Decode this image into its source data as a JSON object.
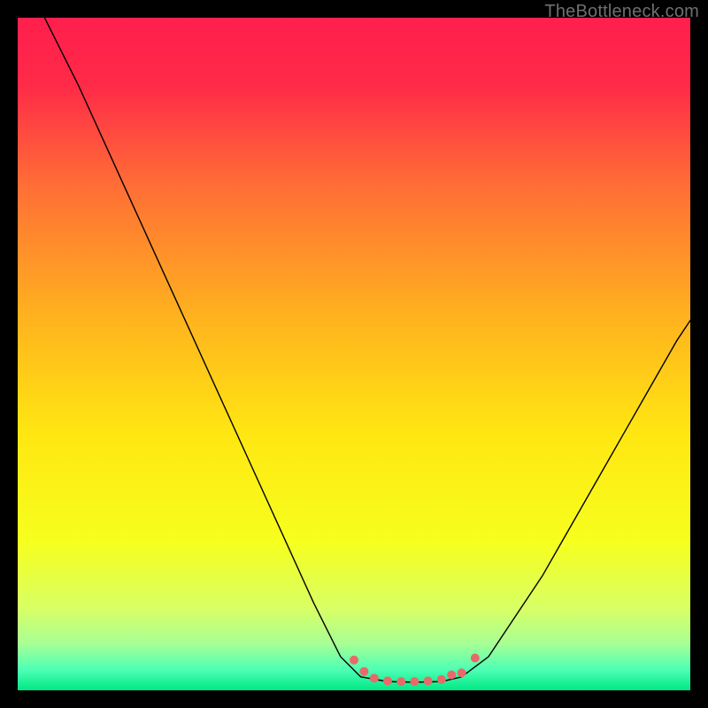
{
  "watermark": "TheBottleneck.com",
  "chart_data": {
    "type": "line",
    "title": "",
    "xlabel": "",
    "ylabel": "",
    "xlim": [
      0,
      100
    ],
    "ylim": [
      0,
      100
    ],
    "grid": false,
    "legend": false,
    "background_gradient": {
      "stops": [
        {
          "pos": 0.0,
          "color": "#ff1f4d"
        },
        {
          "pos": 0.1,
          "color": "#ff2a48"
        },
        {
          "pos": 0.25,
          "color": "#ff6e36"
        },
        {
          "pos": 0.45,
          "color": "#ffb41e"
        },
        {
          "pos": 0.62,
          "color": "#ffe712"
        },
        {
          "pos": 0.78,
          "color": "#f6ff1e"
        },
        {
          "pos": 0.88,
          "color": "#d7ff66"
        },
        {
          "pos": 0.93,
          "color": "#a8ff94"
        },
        {
          "pos": 0.97,
          "color": "#4cffb4"
        },
        {
          "pos": 1.0,
          "color": "#00e884"
        }
      ]
    },
    "series": [
      {
        "name": "curve-left",
        "color": "#000000",
        "width": 1.4,
        "x": [
          4.0,
          9.0,
          14.0,
          19.0,
          24.0,
          29.0,
          34.0,
          39.0,
          44.0,
          48.0,
          51.0
        ],
        "y": [
          100.0,
          90.0,
          79.0,
          68.0,
          57.0,
          46.0,
          35.0,
          24.0,
          13.0,
          5.0,
          2.0
        ]
      },
      {
        "name": "curve-right",
        "color": "#000000",
        "width": 1.4,
        "x": [
          66.0,
          70.0,
          74.0,
          78.0,
          82.0,
          86.0,
          90.0,
          94.0,
          98.0,
          100.0
        ],
        "y": [
          2.0,
          5.0,
          11.0,
          17.0,
          24.0,
          31.0,
          38.0,
          45.0,
          52.0,
          55.0
        ]
      },
      {
        "name": "flat-bottom",
        "color": "#000000",
        "width": 1.4,
        "x": [
          51.0,
          55.0,
          59.0,
          63.0,
          66.0
        ],
        "y": [
          2.0,
          1.3,
          1.2,
          1.3,
          2.0
        ]
      },
      {
        "name": "marker-trail",
        "type": "scatter",
        "color": "#e76a6a",
        "radius": 5,
        "x": [
          50.0,
          51.5,
          53.0,
          55.0,
          57.0,
          59.0,
          61.0,
          63.0,
          64.5,
          66.0,
          68.0
        ],
        "y": [
          4.5,
          2.8,
          1.8,
          1.4,
          1.3,
          1.3,
          1.4,
          1.6,
          2.3,
          2.6,
          4.8
        ]
      }
    ]
  }
}
